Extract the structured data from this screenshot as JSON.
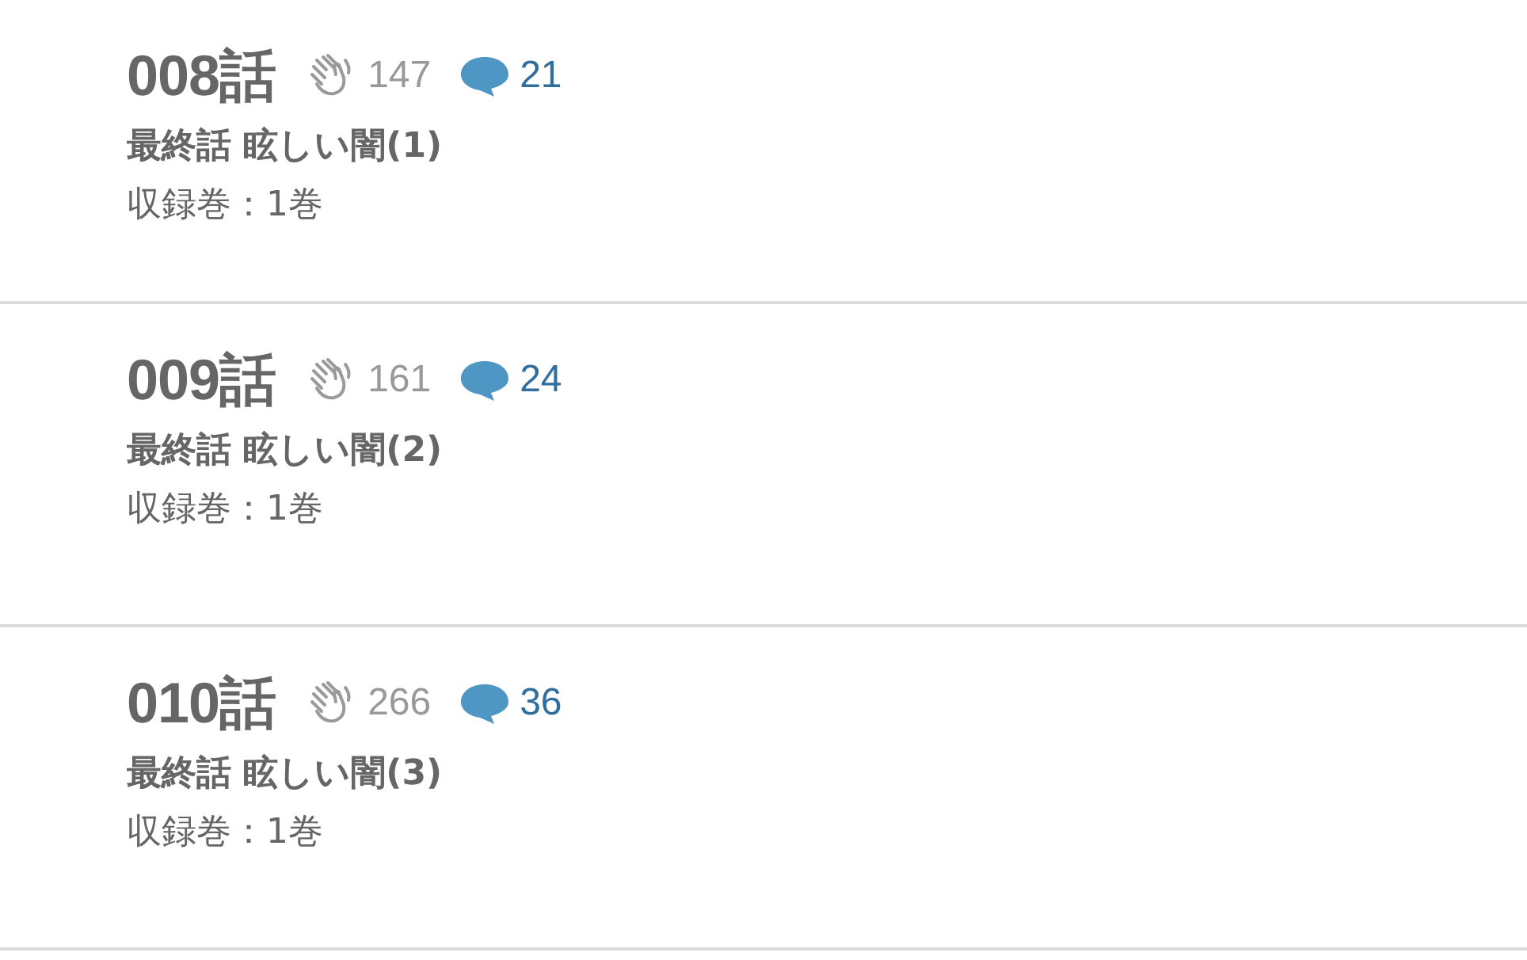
{
  "episodes": [
    {
      "number": "008話",
      "claps": "147",
      "comments": "21",
      "title": "最終話 眩しい闇(1)",
      "volume": "収録巻：1巻"
    },
    {
      "number": "009話",
      "claps": "161",
      "comments": "24",
      "title": "最終話 眩しい闇(2)",
      "volume": "収録巻：1巻"
    },
    {
      "number": "010話",
      "claps": "266",
      "comments": "36",
      "title": "最終話 眩しい闇(3)",
      "volume": "収録巻：1巻"
    }
  ]
}
